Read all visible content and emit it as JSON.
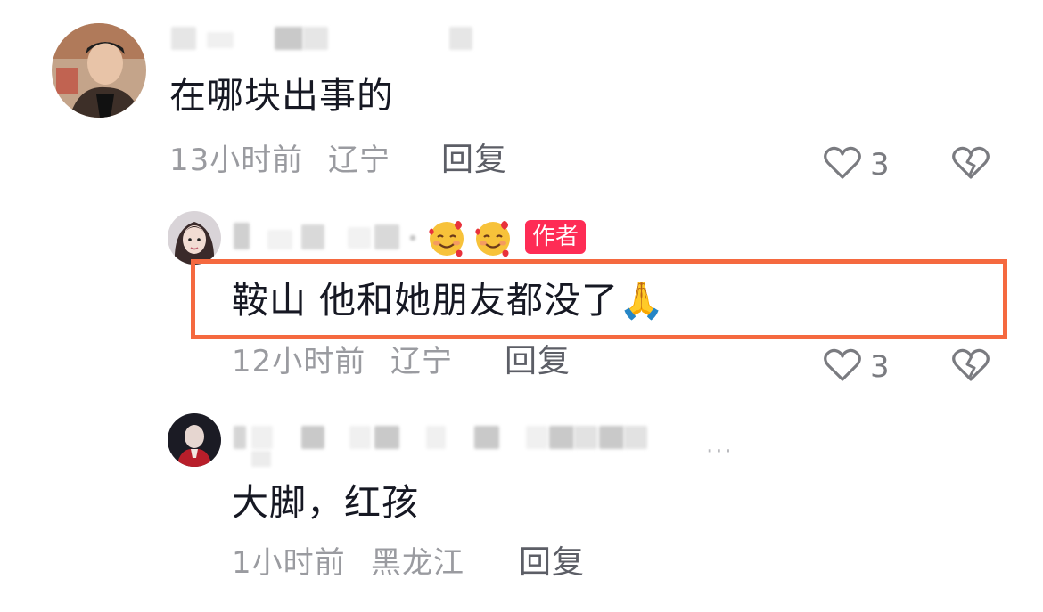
{
  "comments": [
    {
      "text": "在哪块出事的",
      "time": "13小时前",
      "location": "辽宁",
      "reply_label": "回复",
      "likes": "3"
    },
    {
      "author_tag": "作者",
      "text": "鞍山 他和她朋友都没了🙏",
      "time": "12小时前",
      "location": "辽宁",
      "reply_label": "回复",
      "likes": "3"
    },
    {
      "text": "大脚，红孩",
      "time": "1小时前",
      "location": "黑龙江",
      "reply_label": "回复"
    }
  ],
  "colors": {
    "highlight": "#f5693f",
    "author_tag": "#fe2c55"
  },
  "icons": {
    "like": "heart-outline-icon",
    "dislike": "broken-heart-icon",
    "more": "more-dots-icon"
  }
}
